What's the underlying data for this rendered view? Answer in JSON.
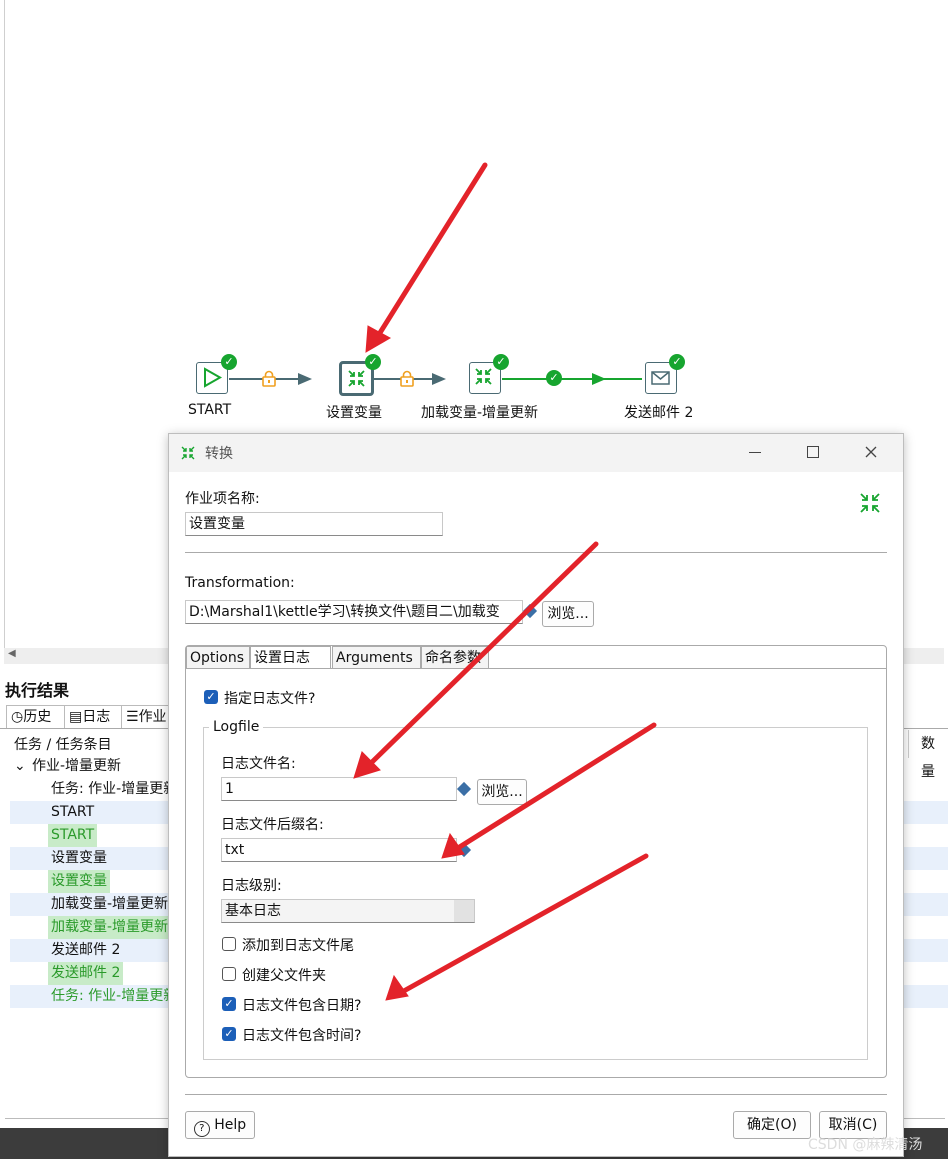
{
  "canvas": {
    "nodes": [
      {
        "label": "START",
        "icon": "play-icon"
      },
      {
        "label": "设置变量",
        "icon": "transform-icon"
      },
      {
        "label": "加载变量-增量更新",
        "icon": "transform-icon"
      },
      {
        "label": "发送邮件 2",
        "icon": "mail-icon"
      }
    ]
  },
  "results": {
    "title": "执行结果",
    "tabs": [
      "历史",
      "日志",
      "作业"
    ],
    "column_header": "任务 / 任务条目",
    "column_header_right": "数量",
    "rows": [
      {
        "text": "作业-增量更新",
        "expander": "⌄"
      },
      {
        "text": "任务: 作业-增量更新"
      },
      {
        "text": "START"
      },
      {
        "text": "START"
      },
      {
        "text": "设置变量"
      },
      {
        "text": "设置变量"
      },
      {
        "text": "加载变量-增量更新"
      },
      {
        "text": "加载变量-增量更新"
      },
      {
        "text": "发送邮件 2"
      },
      {
        "text": "发送邮件 2"
      },
      {
        "text": "任务: 作业-增量更新"
      }
    ]
  },
  "dialog": {
    "title": "转换",
    "job_name_label": "作业项名称:",
    "job_name_value": "设置变量",
    "transformation_label": "Transformation:",
    "transformation_path": "D:\\Marshal1\\kettle学习\\转换文件\\题目二\\加载变",
    "browse_label": "浏览...",
    "tabs": [
      "Options",
      "设置日志",
      "Arguments",
      "命名参数"
    ],
    "specify_logfile_label": "指定日志文件?",
    "logfile_group_label": "Logfile",
    "logfile_name_label": "日志文件名:",
    "logfile_name_value": "1",
    "logfile_ext_label": "日志文件后缀名:",
    "logfile_ext_value": "txt",
    "log_level_label": "日志级别:",
    "log_level_value": "基本日志",
    "append_label": "添加到日志文件尾",
    "create_parent_label": "创建父文件夹",
    "include_date_label": "日志文件包含日期?",
    "include_time_label": "日志文件包含时间?",
    "help_label": "Help",
    "ok_label": "确定(O)",
    "cancel_label": "取消(C)",
    "checkboxes": {
      "specify_logfile": true,
      "append": false,
      "create_parent": false,
      "include_date": true,
      "include_time": true
    }
  },
  "watermark": "CSDN @麻辣清汤",
  "colors": {
    "ok_green": "#17a52f",
    "arrow_red": "#e3232a",
    "checkbox_blue": "#1c5fb8",
    "lock_orange": "#f0a020"
  }
}
